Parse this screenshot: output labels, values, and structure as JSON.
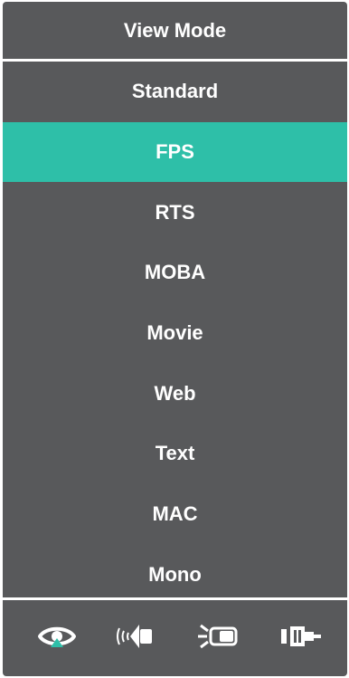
{
  "menu": {
    "title": "View Mode",
    "items": [
      {
        "label": "Standard",
        "selected": false
      },
      {
        "label": "FPS",
        "selected": true
      },
      {
        "label": "RTS",
        "selected": false
      },
      {
        "label": "MOBA",
        "selected": false
      },
      {
        "label": "Movie",
        "selected": false
      },
      {
        "label": "Web",
        "selected": false
      },
      {
        "label": "Text",
        "selected": false
      },
      {
        "label": "MAC",
        "selected": false
      },
      {
        "label": "Mono",
        "selected": false
      }
    ]
  },
  "tabs": [
    {
      "icon": "eye-icon",
      "active": true
    },
    {
      "icon": "speaker-icon",
      "active": false
    },
    {
      "icon": "display-brightness-icon",
      "active": false
    },
    {
      "icon": "input-connector-icon",
      "active": false
    }
  ],
  "colors": {
    "background": "#58595b",
    "accent": "#2ebfa8",
    "text": "#ffffff"
  }
}
